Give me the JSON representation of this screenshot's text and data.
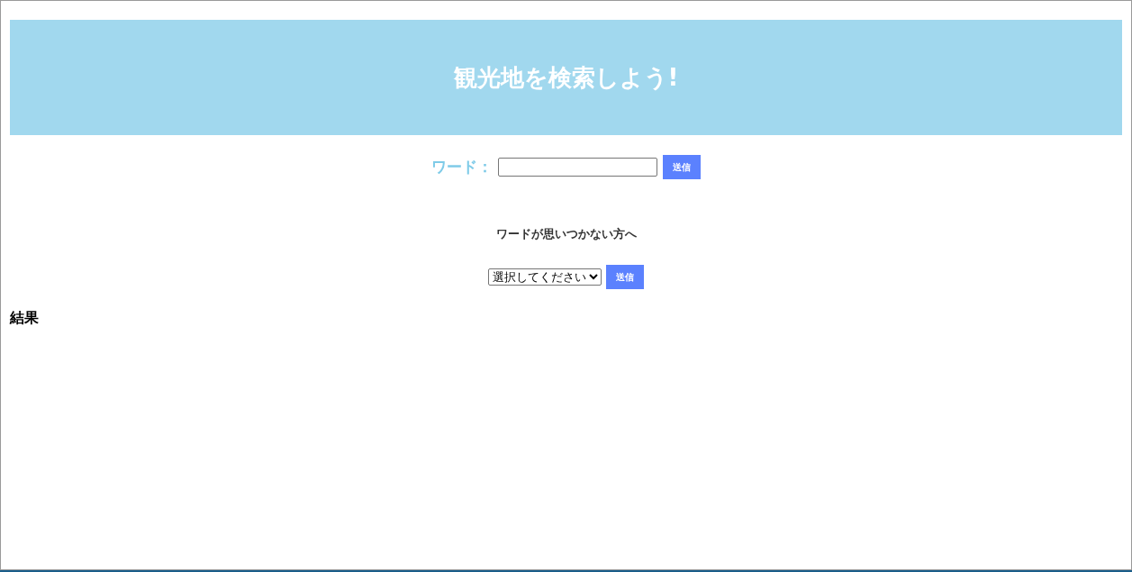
{
  "header": {
    "title": "観光地を検索しよう!"
  },
  "word_search": {
    "label": "ワード：",
    "button": "送信"
  },
  "suggestion": {
    "text": "ワードが思いつかない方へ",
    "select": "選択してください",
    "button": "送信"
  },
  "results": {
    "heading": "結果"
  }
}
